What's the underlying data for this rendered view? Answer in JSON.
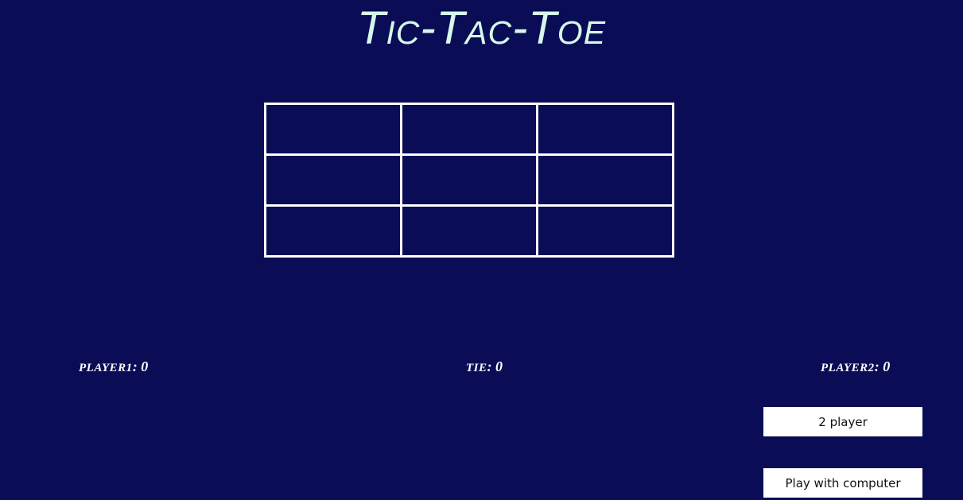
{
  "title": "Tic-Tac-Toe",
  "board": {
    "rows": [
      [
        "",
        "",
        ""
      ],
      [
        "",
        "",
        ""
      ],
      [
        "",
        "",
        ""
      ]
    ]
  },
  "scores": {
    "player1_label": "PLAYER1",
    "player1_value": "0",
    "tie_label": "TIE",
    "tie_value": "0",
    "player2_label": "PLAYER2",
    "player2_value": "0"
  },
  "buttons": {
    "two_player": "2 player",
    "computer": "Play with computer"
  },
  "colors": {
    "background": "#0a0d55",
    "title": "#d6f7e9",
    "grid": "#ffffff"
  }
}
